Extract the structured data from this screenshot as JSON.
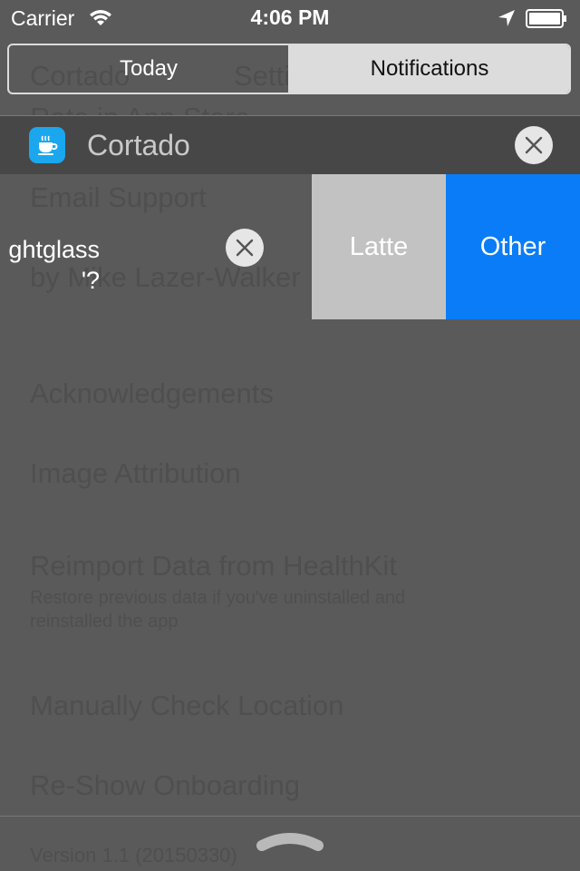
{
  "status_bar": {
    "carrier": "Carrier",
    "time": "4:06 PM",
    "icons": [
      "wifi-icon",
      "location-arrow-icon",
      "battery-icon"
    ]
  },
  "segmented": {
    "today": "Today",
    "notifications": "Notifications",
    "selected": "Notifications"
  },
  "notification_group": {
    "app_name": "Cortado",
    "app_icon": "coffee-cup-icon",
    "accent": "#1aa7ee"
  },
  "notification": {
    "line1": "ghtglass",
    "line2": "'?",
    "actions": [
      {
        "label": "Latte",
        "color": "#c2c2c2"
      },
      {
        "label": "Other",
        "color": "#0a7cf7"
      }
    ]
  },
  "background_screen": {
    "title_left": "Cortado",
    "title_right": "Settings",
    "rows": [
      "Rate in App Store",
      "Email Support",
      "by Mike Lazer-Walker",
      "Acknowledgements",
      "Image Attribution",
      "Reimport Data from HealthKit",
      "Manually Check Location",
      "Re-Show Onboarding",
      "Version 1.1 (20150330)"
    ],
    "reimport_subtitle_line1": "Restore previous data if you've uninstalled and",
    "reimport_subtitle_line2": "reinstalled the app"
  }
}
